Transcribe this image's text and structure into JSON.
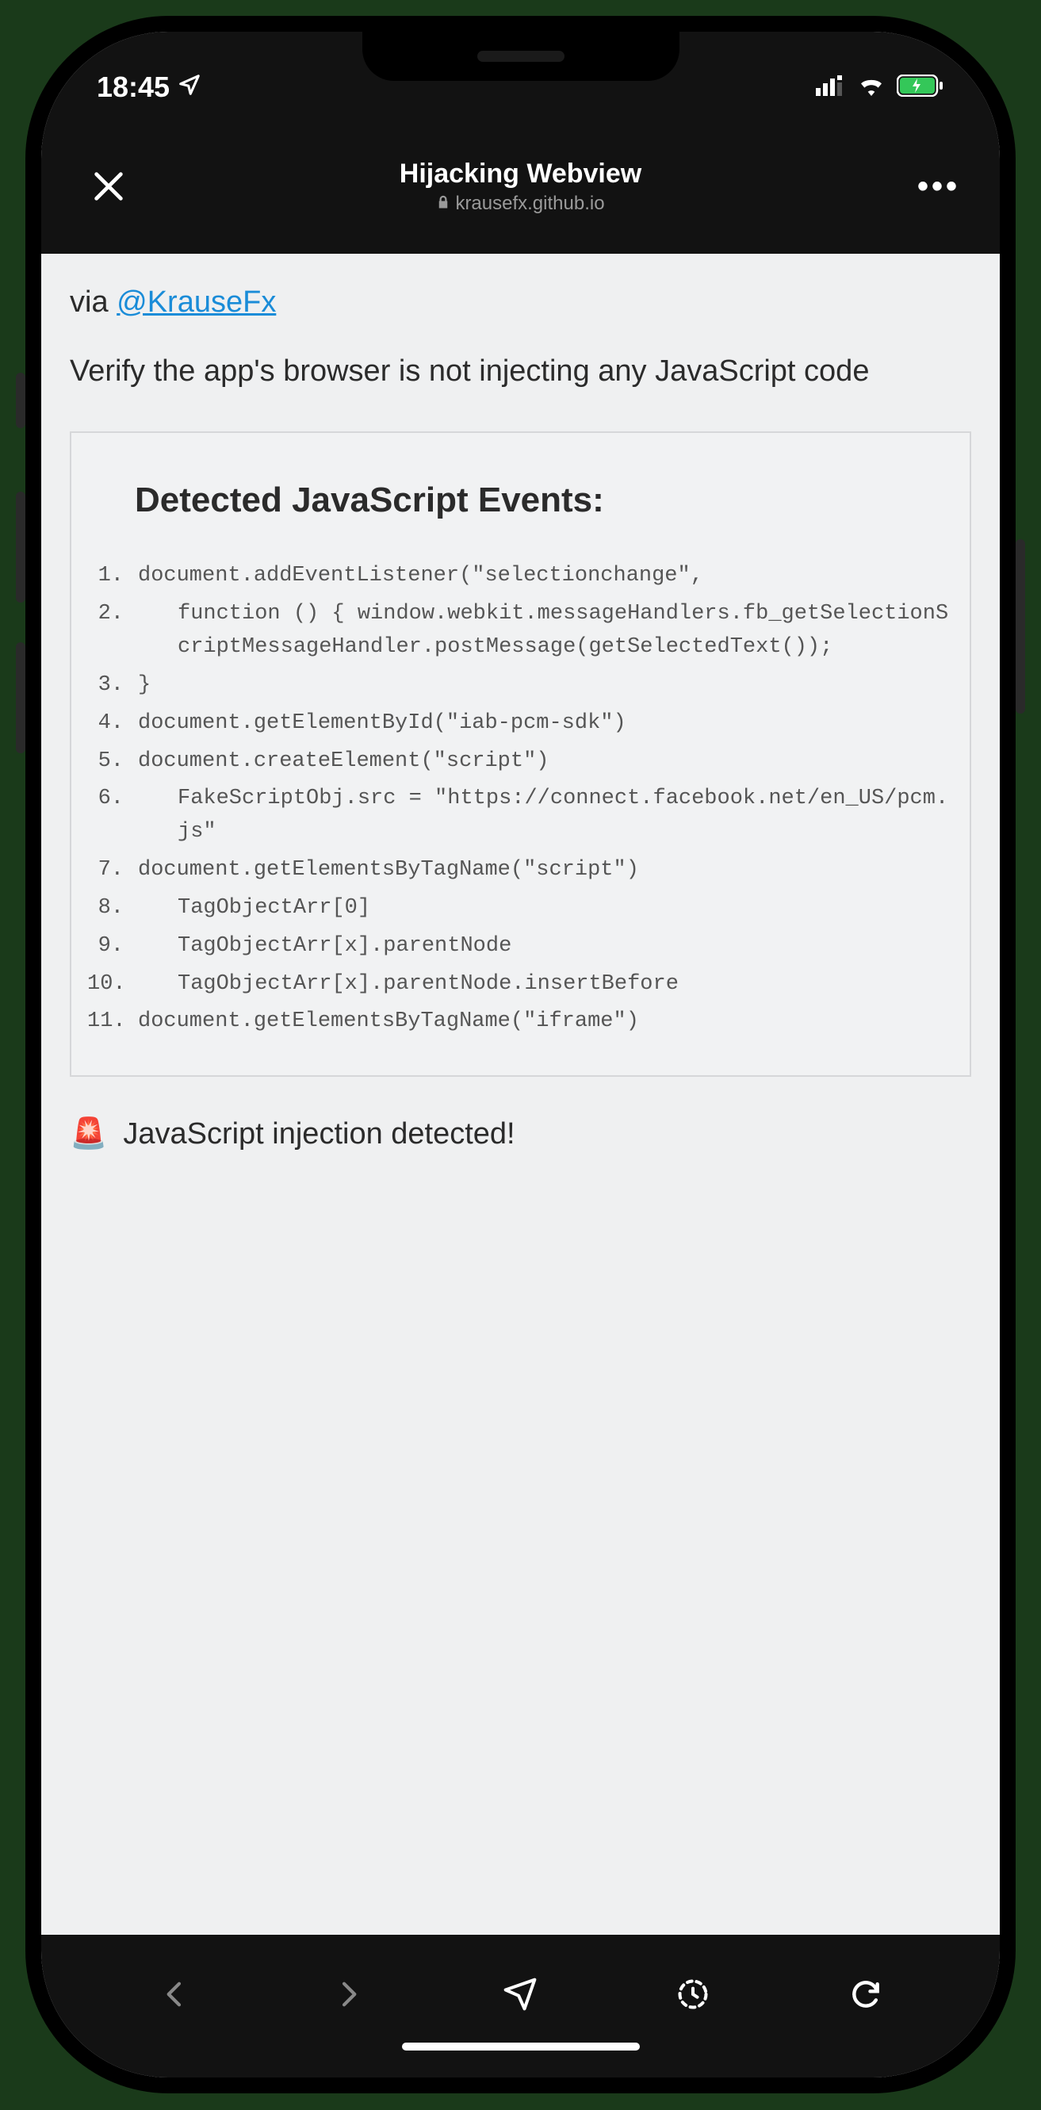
{
  "status": {
    "time": "18:45",
    "location_icon": "location-arrow",
    "signal_icon": "cellular",
    "wifi_icon": "wifi",
    "battery_icon": "battery-charging"
  },
  "nav": {
    "title": "Hijacking Webview",
    "domain": "krausefx.github.io",
    "close_icon": "close-x",
    "more_icon": "ellipsis",
    "lock_icon": "lock"
  },
  "content": {
    "via_prefix": "via ",
    "via_handle": "@KrauseFx",
    "subtitle": "Verify the app's browser is not injecting any JavaScript code",
    "panel_heading": "Detected JavaScript Events:",
    "events": [
      {
        "n": "1.",
        "code": "document.addEventListener(\"selectionchange\",",
        "indent": false
      },
      {
        "n": "2.",
        "code": "function () { window.webkit.messageHandlers.fb_getSelectionScriptMessageHandler.postMessage(getSelectedText());",
        "indent": true
      },
      {
        "n": "3.",
        "code": "}",
        "indent": false
      },
      {
        "n": "4.",
        "code": "document.getElementById(\"iab-pcm-sdk\")",
        "indent": false
      },
      {
        "n": "5.",
        "code": "document.createElement(\"script\")",
        "indent": false
      },
      {
        "n": "6.",
        "code": "FakeScriptObj.src = \"https://connect.facebook.net/en_US/pcm.js\"",
        "indent": true
      },
      {
        "n": "7.",
        "code": "document.getElementsByTagName(\"script\")",
        "indent": false
      },
      {
        "n": "8.",
        "code": "TagObjectArr[0]",
        "indent": true
      },
      {
        "n": "9.",
        "code": "TagObjectArr[x].parentNode",
        "indent": true
      },
      {
        "n": "10.",
        "code": "TagObjectArr[x].parentNode.insertBefore",
        "indent": true
      },
      {
        "n": "11.",
        "code": "document.getElementsByTagName(\"iframe\")",
        "indent": false
      }
    ],
    "warning_icon": "🚨",
    "warning_text": "JavaScript injection detected!"
  },
  "toolbar": {
    "back_icon": "chevron-left",
    "forward_icon": "chevron-right",
    "share_icon": "paper-plane",
    "history_icon": "history-clock",
    "reload_icon": "reload-ccw"
  }
}
